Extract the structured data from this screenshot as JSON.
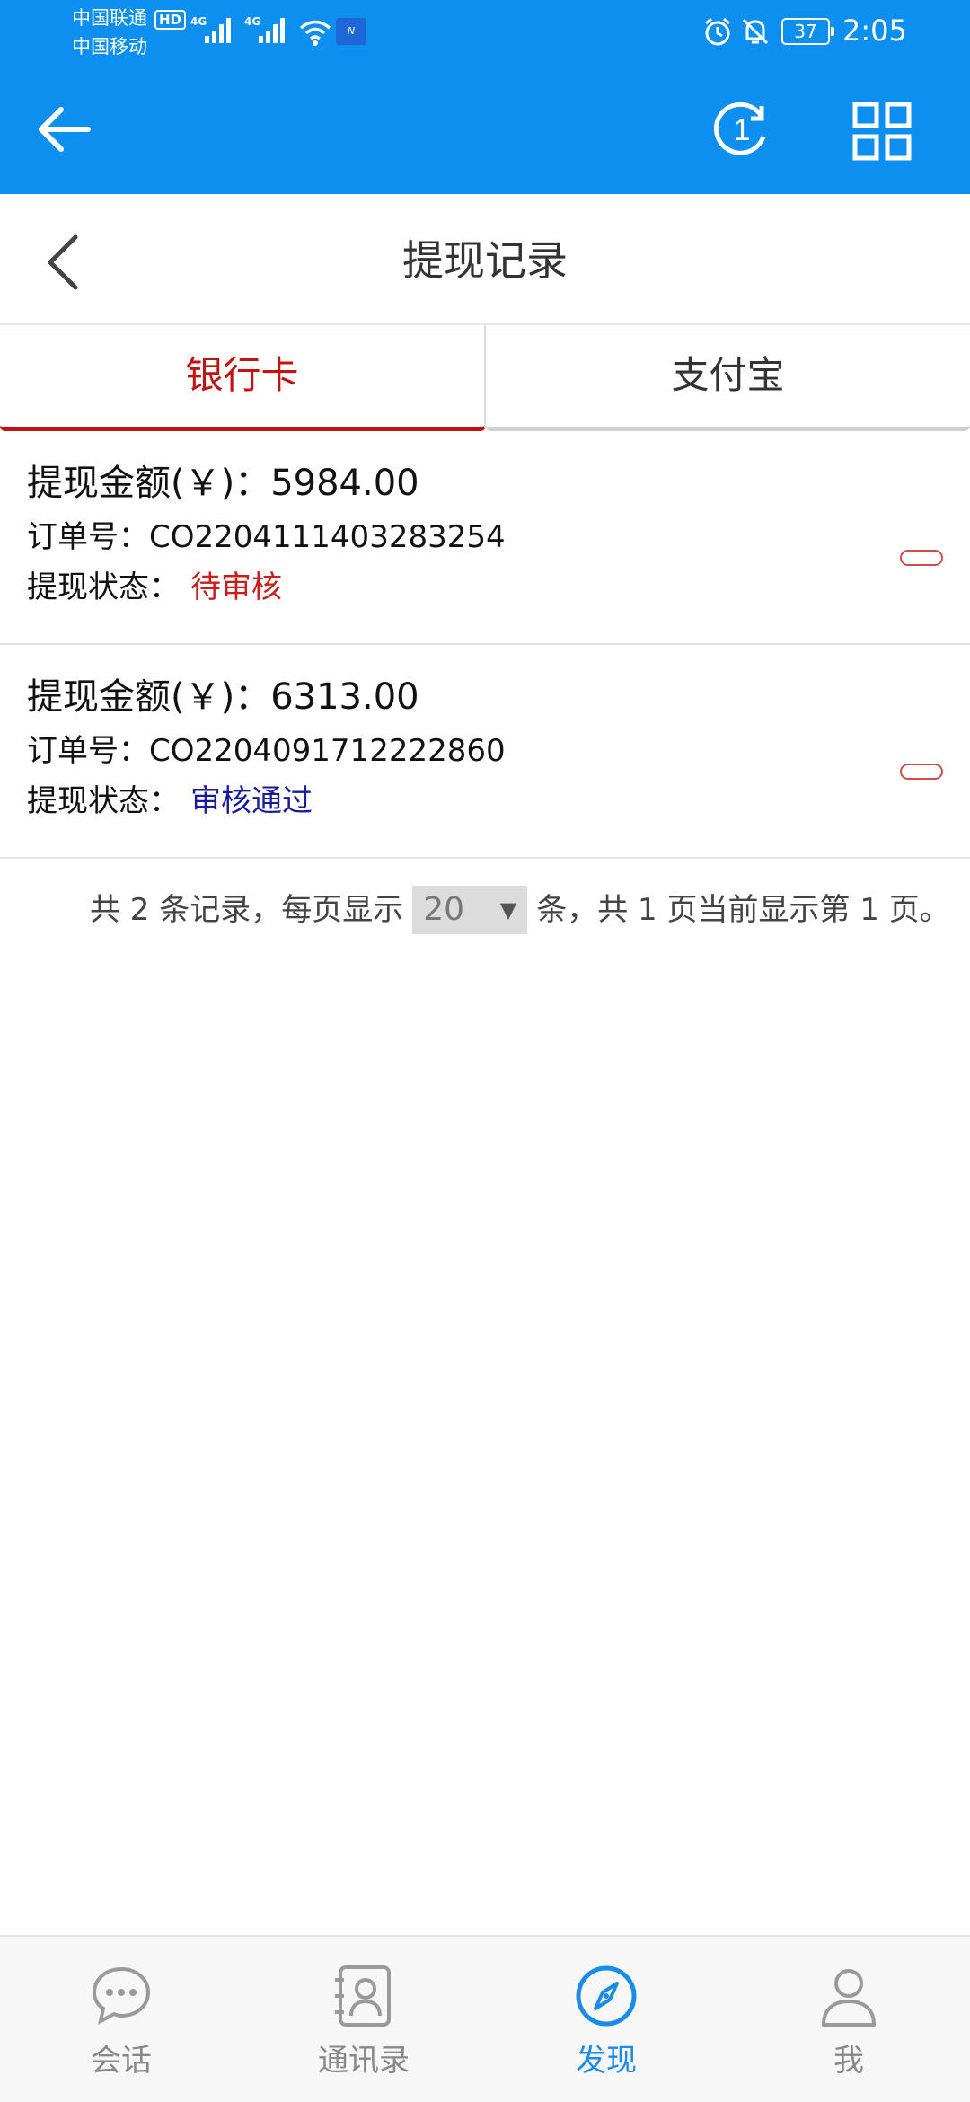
{
  "status_bar": {
    "carrier_1": "中国联通",
    "carrier_2": "中国移动",
    "hd_badge": "HD",
    "signal_1_label": "4G",
    "signal_2_label": "4G",
    "battery": "37",
    "time": "2:05",
    "icons": [
      "signal-icon",
      "wifi-icon",
      "nfc-icon",
      "alarm-icon",
      "bell-off-icon",
      "battery-icon"
    ]
  },
  "app_bar": {
    "icons": [
      "back-arrow-icon",
      "history-icon",
      "grid-menu-icon"
    ],
    "background": "#0d8fef"
  },
  "page": {
    "title": "提现记录"
  },
  "tabs": [
    {
      "label": "银行卡",
      "active": true
    },
    {
      "label": "支付宝",
      "active": false
    }
  ],
  "records": [
    {
      "amount": "提现金额(￥)：5984.00",
      "order": "订单号：CO2204111403283254",
      "status_label": "提现状态：",
      "status_value": "待审核",
      "status_color": "#c81e1e"
    },
    {
      "amount": "提现金额(￥)：6313.00",
      "order": "订单号：CO2204091712222860",
      "status_label": "提现状态：",
      "status_value": "审核通过",
      "status_color": "#1a1aa0"
    }
  ],
  "pagination": {
    "prefix": "共 2 条记录，每页显示",
    "page_size": "20",
    "suffix": "条，共 1 页当前显示第 1 页。"
  },
  "bottom_nav": [
    {
      "label": "会话",
      "icon": "chat-icon",
      "active": false
    },
    {
      "label": "通讯录",
      "icon": "contacts-icon",
      "active": false
    },
    {
      "label": "发现",
      "icon": "compass-icon",
      "active": true
    },
    {
      "label": "我",
      "icon": "person-icon",
      "active": false
    }
  ],
  "colors": {
    "accent_red": "#c3130f",
    "nav_active": "#1a8ce8"
  }
}
